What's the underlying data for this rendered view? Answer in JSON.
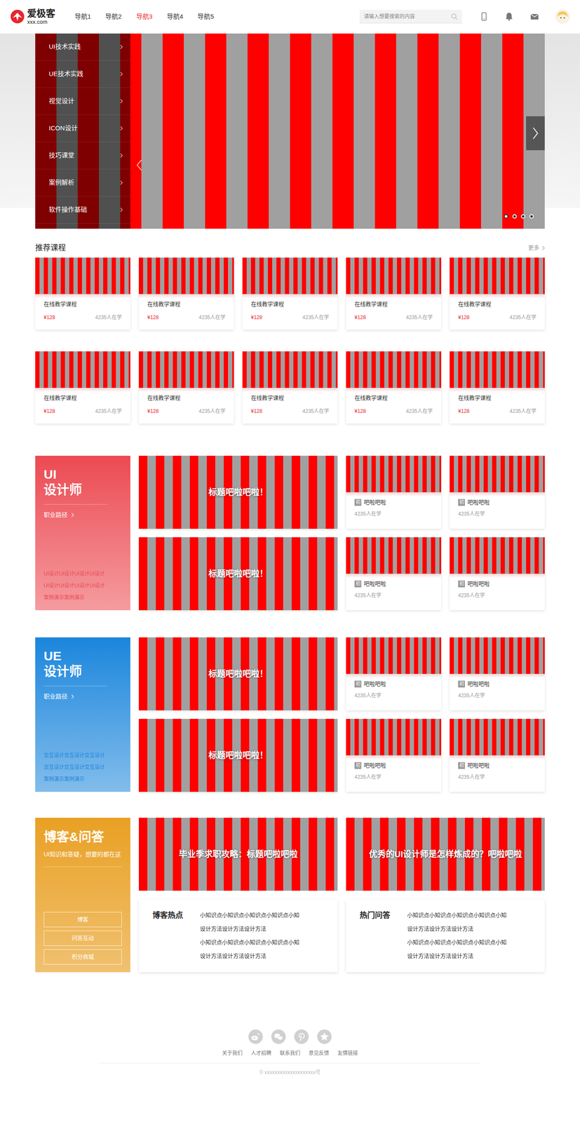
{
  "logo": {
    "name": "爱极客",
    "domain": "xxx.com"
  },
  "nav": [
    {
      "label": "导航1",
      "selected": false
    },
    {
      "label": "导航2",
      "selected": false
    },
    {
      "label": "导航3",
      "selected": true
    },
    {
      "label": "导航4",
      "selected": false
    },
    {
      "label": "导航5",
      "selected": false
    }
  ],
  "search": {
    "placeholder": "请输入想要搜索的内容"
  },
  "banner": {
    "menu": [
      "UI技术实践",
      "UE技术实践",
      "视觉设计",
      "ICON设计",
      "技巧课堂",
      "案例解析",
      "软件操作基础"
    ],
    "dots": [
      {
        "selected": true
      },
      {
        "selected": false
      },
      {
        "selected": false
      },
      {
        "selected": false
      }
    ]
  },
  "recommended": {
    "title": "推荐课程",
    "more": "更多",
    "courses": [
      {
        "title": "在线教学课程",
        "price": "¥128",
        "students": "4235人在学"
      },
      {
        "title": "在线教学课程",
        "price": "¥128",
        "students": "4235人在学"
      },
      {
        "title": "在线教学课程",
        "price": "¥128",
        "students": "4235人在学"
      },
      {
        "title": "在线教学课程",
        "price": "¥128",
        "students": "4235人在学"
      },
      {
        "title": "在线教学课程",
        "price": "¥128",
        "students": "4235人在学"
      },
      {
        "title": "在线教学课程",
        "price": "¥128",
        "students": "4235人在学"
      },
      {
        "title": "在线教学课程",
        "price": "¥128",
        "students": "4235人在学"
      },
      {
        "title": "在线教学课程",
        "price": "¥128",
        "students": "4235人在学"
      },
      {
        "title": "在线教学课程",
        "price": "¥128",
        "students": "4235人在学"
      },
      {
        "title": "在线教学课程",
        "price": "¥128",
        "students": "4235人在学"
      }
    ]
  },
  "tracks": [
    {
      "title": "UI",
      "subtitle": "设计师",
      "path": "职业路径",
      "color": "#ec4a52",
      "desc": [
        "UI设计UI设计UI设计UI设计",
        "UI设计UI设计UI设计UI设计",
        "案例演示案例演示"
      ],
      "features": [
        "标题吧啦吧啦！",
        "标题吧啦吧啦！"
      ],
      "cards": [
        {
          "tag": "初",
          "title": "吧啦吧啦",
          "students": "4235人在学"
        },
        {
          "tag": "初",
          "title": "吧啦吧啦",
          "students": "4235人在学"
        },
        {
          "tag": "初",
          "title": "吧啦吧啦",
          "students": "4235人在学"
        },
        {
          "tag": "初",
          "title": "吧啦吧啦",
          "students": "4235人在学"
        }
      ]
    },
    {
      "title": "UE",
      "subtitle": "设计师",
      "path": "职业路径",
      "color": "#1b86dc",
      "desc": [
        "交互设计交互设计交互设计",
        "交互设计交互设计交互设计",
        "案例演示案例演示"
      ],
      "features": [
        "标题吧啦吧啦！",
        "标题吧啦吧啦！"
      ],
      "cards": [
        {
          "tag": "初",
          "title": "吧啦吧啦",
          "students": "4235人在学"
        },
        {
          "tag": "初",
          "title": "吧啦吧啦",
          "students": "4235人在学"
        },
        {
          "tag": "初",
          "title": "吧啦吧啦",
          "students": "4235人在学"
        },
        {
          "tag": "初",
          "title": "吧啦吧啦",
          "students": "4235人在学"
        }
      ]
    }
  ],
  "blog": {
    "title": "博客&问答",
    "subtitle": "UI知识和答疑，想要的都在这",
    "color": "#e9a024",
    "buttons": [
      "博客",
      "问答互动",
      "积分商城"
    ],
    "posts": [
      "毕业季求职攻略：标题吧啦吧啦",
      "优秀的UI设计师是怎样炼成的？吧啦吧啦"
    ],
    "lists": [
      {
        "title": "博客热点",
        "lines": [
          "小知识点小知识点小知识点小知识点小知",
          "设计方法设计方法设计方法",
          "小知识点小知识点小知识点小知识点小知",
          "设计方法设计方法设计方法"
        ]
      },
      {
        "title": "热门问答",
        "lines": [
          "小知识点小知识点小知识点小知识点小知",
          "设计方法设计方法设计方法",
          "小知识点小知识点小知识点小知识点小知",
          "设计方法设计方法设计方法"
        ]
      }
    ]
  },
  "footer": {
    "links": [
      "关于我们",
      "人才招聘",
      "联系我们",
      "意见反馈",
      "友情链接"
    ],
    "copyright": "© xxxxxxxxxxxxxxxxxxxx号"
  }
}
